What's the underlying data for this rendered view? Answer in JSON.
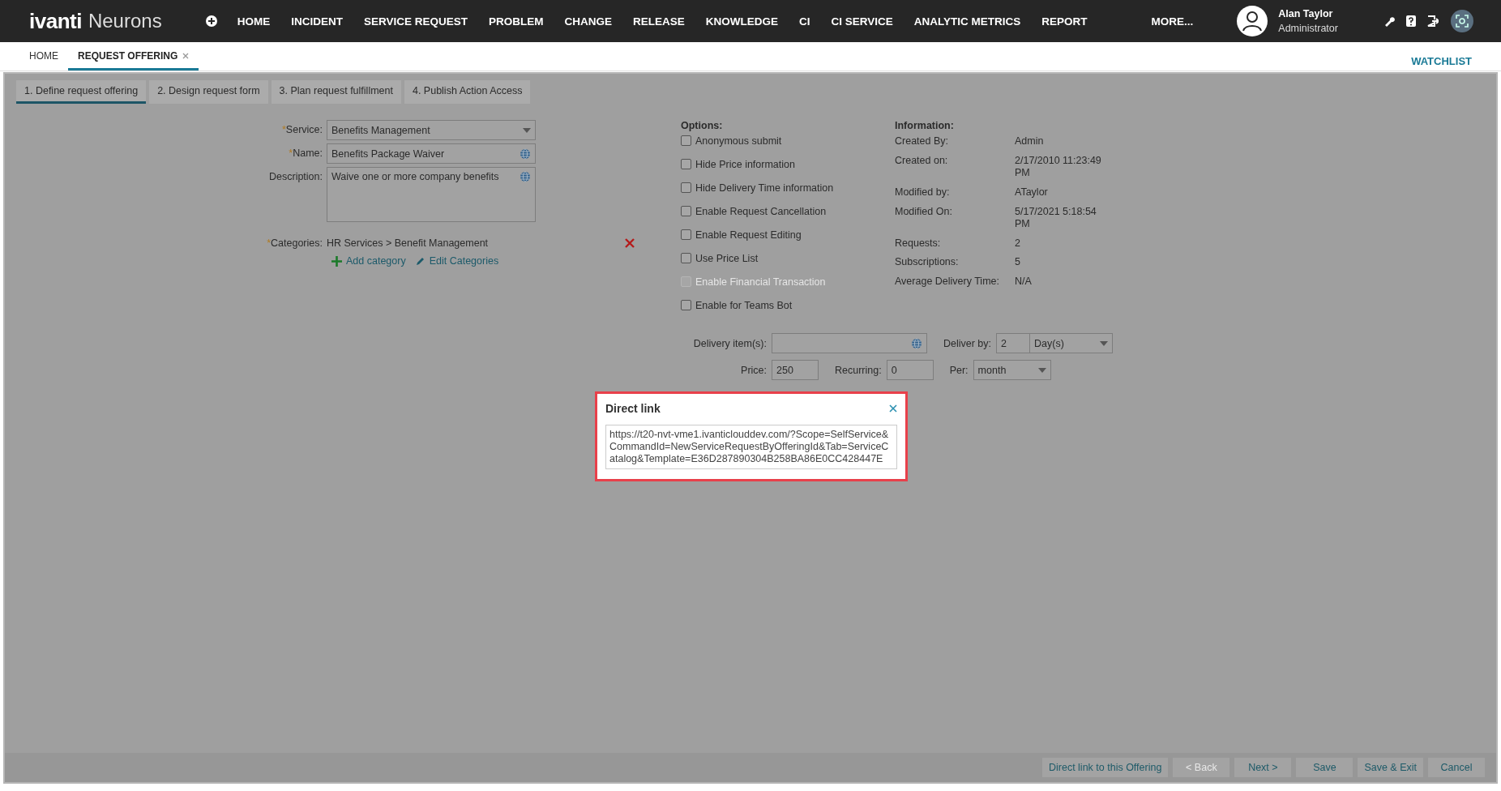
{
  "header": {
    "logo": "ivanti",
    "product": "Neurons",
    "nav": [
      "HOME",
      "INCIDENT",
      "SERVICE REQUEST",
      "PROBLEM",
      "CHANGE",
      "RELEASE",
      "KNOWLEDGE",
      "CI",
      "CI SERVICE",
      "ANALYTIC METRICS",
      "REPORT",
      "MORE..."
    ],
    "user": {
      "name": "Alan Taylor",
      "role": "Administrator"
    }
  },
  "tabs": [
    {
      "label": "HOME",
      "selected": false,
      "closable": false
    },
    {
      "label": "REQUEST OFFERING",
      "selected": true,
      "closable": true
    }
  ],
  "watchlist": "WATCHLIST",
  "steps": [
    {
      "label": "1. Define request offering",
      "selected": true
    },
    {
      "label": "2. Design request form",
      "selected": false
    },
    {
      "label": "3. Plan request fulfillment",
      "selected": false
    },
    {
      "label": "4. Publish Action Access",
      "selected": false
    }
  ],
  "form": {
    "fields": [
      {
        "kind": "select",
        "marker": "*",
        "label": "Service:",
        "value": "Benefits Management"
      },
      {
        "kind": "text",
        "marker": "*",
        "label": "Name:",
        "value": "Benefits Package Waiver"
      },
      {
        "kind": "textarea",
        "label": "Description:",
        "value": "Waive one or more company benefits"
      }
    ],
    "categories": {
      "marker": "*",
      "label": "Categories:",
      "value": "HR Services > Benefit Management"
    },
    "add_category": "Add category",
    "edit_categories": "Edit Categories"
  },
  "options": {
    "title": "Options:",
    "items": [
      {
        "label": "Anonymous submit",
        "checked": false,
        "disabled": false
      },
      {
        "label": "Hide Price information",
        "checked": false,
        "disabled": false
      },
      {
        "label": "Hide Delivery Time information",
        "checked": false,
        "disabled": false
      },
      {
        "label": "Enable Request Cancellation",
        "checked": false,
        "disabled": false
      },
      {
        "label": "Enable Request Editing",
        "checked": false,
        "disabled": false
      },
      {
        "label": "Use Price List",
        "checked": false,
        "disabled": false
      },
      {
        "label": "Enable Financial Transaction",
        "checked": false,
        "disabled": true
      },
      {
        "label": "Enable for Teams Bot",
        "checked": false,
        "disabled": false
      }
    ]
  },
  "information": {
    "title": "Information:",
    "rows": [
      {
        "label": "Created By:",
        "value": "Admin"
      },
      {
        "label": "Created on:",
        "value": "2/17/2010 11:23:49 PM"
      },
      {
        "label": "Modified by:",
        "value": "ATaylor"
      },
      {
        "label": "Modified On:",
        "value": "5/17/2021 5:18:54 PM"
      },
      {
        "label": "Requests:",
        "value": "2"
      },
      {
        "label": "Subscriptions:",
        "value": "5"
      },
      {
        "label": "Average Delivery Time:",
        "value": "N/A"
      }
    ]
  },
  "delivery": {
    "items_label": "Delivery item(s):",
    "deliver_by_label": "Deliver by:",
    "deliver_by_value": "2",
    "deliver_by_unit": "Day(s)"
  },
  "pricing": {
    "price_label": "Price:",
    "price": "250",
    "recurring_label": "Recurring:",
    "recurring": "0",
    "per_label": "Per:",
    "per": "month"
  },
  "dialog": {
    "title": "Direct link",
    "url": "https://t20-nvt-vme1.ivanticlouddev.com/?Scope=SelfService&CommandId=NewServiceRequestByOfferingId&Tab=ServiceCatalog&Template=E36D287890304B258BA86E0CC428447E"
  },
  "footer_buttons": [
    {
      "label": "Direct link to this Offering",
      "disabled": false
    },
    {
      "label": "< Back",
      "disabled": true
    },
    {
      "label": "Next >",
      "disabled": false
    },
    {
      "label": "Save",
      "disabled": false
    },
    {
      "label": "Save & Exit",
      "disabled": false
    },
    {
      "label": "Cancel",
      "disabled": false
    }
  ]
}
